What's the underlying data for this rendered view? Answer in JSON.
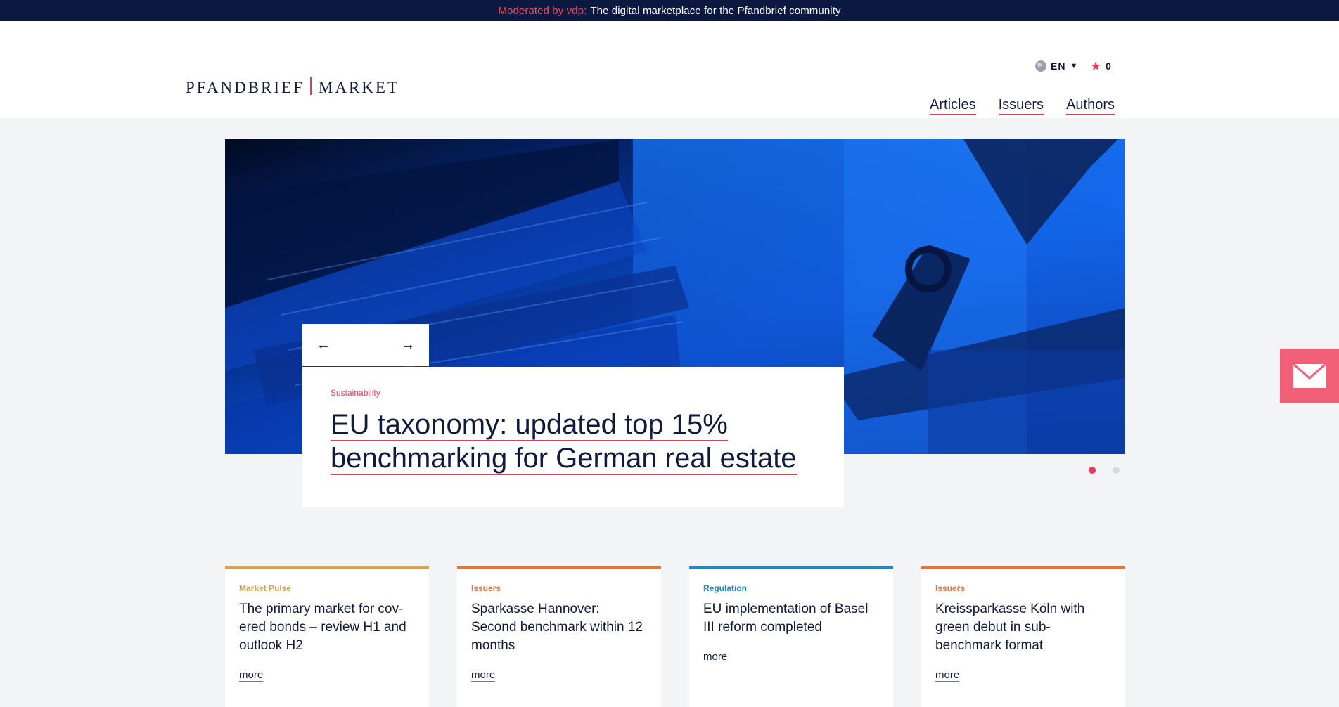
{
  "topbar": {
    "moderated": "Moderated by vdp:",
    "tagline": "The digital marketplace for the Pfandbrief community"
  },
  "header": {
    "logo_left": "PFANDBRIEF",
    "logo_right": "MARKET",
    "language": "EN",
    "favorites_count": "0",
    "nav": [
      "Articles",
      "Issuers",
      "Authors"
    ]
  },
  "hero": {
    "category": "Sustainability",
    "title_line1": "EU taxonomy: updated top 15%",
    "title_line2": "benchmarking for German real estate",
    "prev_icon": "arrow-left-icon",
    "next_icon": "arrow-right-icon",
    "slides": 2,
    "active_slide": 1
  },
  "cards": [
    {
      "category": "Market Pulse",
      "color": "#d9a14b",
      "title": "The primary market for cov-ered bonds – review H1 and outlook H2",
      "more": "more"
    },
    {
      "category": "Issuers",
      "color": "#e8743b",
      "title": "Sparkasse Hannover: Second benchmark within 12 months",
      "more": "more"
    },
    {
      "category": "Regulation",
      "color": "#1f87c4",
      "title": "EU implementation of Basel III reform completed",
      "more": "more"
    },
    {
      "category": "Issuers",
      "color": "#e8743b",
      "title": "Kreissparkasse Köln with green debut in sub-benchmark format",
      "more": "more"
    }
  ],
  "colors": {
    "accent": "#e8395a",
    "navy": "#0b1840"
  },
  "icons": {
    "mail": "mail-icon",
    "globe": "globe-icon",
    "star": "star-icon"
  }
}
